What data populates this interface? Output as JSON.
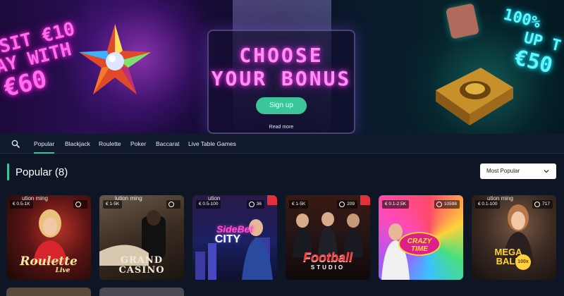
{
  "hero": {
    "left_promo": [
      "OSIT €10",
      "AY WITH",
      "€60"
    ],
    "headline": [
      "CHOOSE",
      "YOUR BONUS"
    ],
    "signup_label": "Sign up",
    "read_more_label": "Read more",
    "right_promo": [
      "100%",
      "UP T",
      "€50"
    ]
  },
  "nav": {
    "tabs": [
      {
        "label": "Popular",
        "active": true
      },
      {
        "label": "Blackjack",
        "active": false
      },
      {
        "label": "Roulette",
        "active": false
      },
      {
        "label": "Poker",
        "active": false
      },
      {
        "label": "Baccarat",
        "active": false
      },
      {
        "label": "Live Table Games",
        "active": false
      }
    ]
  },
  "section": {
    "title": "Popular (8)",
    "sort": {
      "selected": "Most Popular"
    }
  },
  "games": [
    {
      "name": "Roulette Live",
      "limit": "€ 0.5-1K",
      "players": "",
      "watermark": "ution ming"
    },
    {
      "name": "Grand Casino",
      "limit": "€ 1-5K",
      "players": "",
      "watermark": "lution ming"
    },
    {
      "name": "Side Bet City",
      "limit": "€ 0.5-100",
      "players": "36",
      "watermark": "ution"
    },
    {
      "name": "Football Studio",
      "limit": "€ 1-5K",
      "players": "209",
      "watermark": ""
    },
    {
      "name": "Crazy Time",
      "limit": "€ 0.1-2.5K",
      "players": "10598",
      "watermark": ""
    },
    {
      "name": "Mega Ball",
      "limit": "€ 0.1-100",
      "players": "717",
      "watermark": "ution ming"
    }
  ],
  "game_logos": {
    "roulette": "Roulette",
    "roulette_sub": "Live",
    "grand": "GRAND",
    "casino": "CASINO",
    "sidebet": "SideBet",
    "city": "CITY",
    "football": "Football",
    "studio": "STUDIO",
    "crazy": "CRAZY",
    "time": "TIME",
    "mega": "MEGA",
    "ball": "BALL",
    "hundred": "100x"
  },
  "colors": {
    "accent": "#3cc49b",
    "page_bg": "#0e1626",
    "nav_bg": "#101a2c",
    "neon_pink": "#ff6cf0",
    "neon_cyan": "#5ff6ff"
  },
  "icons": {
    "search": "search-icon",
    "chevron": "chevron-down-icon",
    "players": "player-count-icon"
  }
}
